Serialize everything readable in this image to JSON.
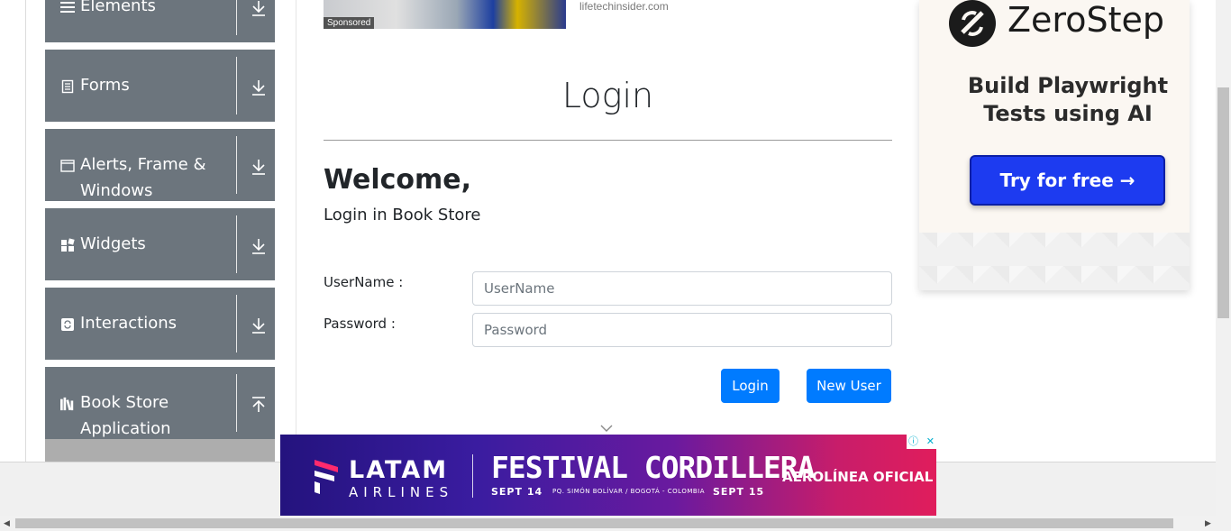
{
  "sidebar": {
    "groups": [
      {
        "label": "Elements",
        "icon": "list-icon",
        "expanded": false
      },
      {
        "label": "Forms",
        "icon": "document-icon",
        "expanded": false
      },
      {
        "label": "Alerts, Frame & Windows",
        "icon": "window-icon",
        "expanded": false
      },
      {
        "label": "Widgets",
        "icon": "grid-icon",
        "expanded": false
      },
      {
        "label": "Interactions",
        "icon": "refresh-icon",
        "expanded": false
      },
      {
        "label": "Book Store Application",
        "icon": "books-icon",
        "expanded": true
      }
    ]
  },
  "top_ad": {
    "sponsored": "Sponsored",
    "domain": "lifetechinsider.com"
  },
  "main": {
    "title": "Login",
    "welcome": "Welcome,",
    "subheading": "Login in Book Store",
    "username_label": "UserName :",
    "username_placeholder": "UserName",
    "password_label": "Password :",
    "password_placeholder": "Password",
    "login_button": "Login",
    "new_user_button": "New User"
  },
  "right_ad": {
    "brand": "ZeroStep",
    "tagline": "Build Playwright Tests using AI",
    "cta": "Try for free →",
    "cta_color": "#1d3bf0"
  },
  "banner_ad": {
    "brand": "LATAM",
    "brand_sub": "AIRLINES",
    "festival": "FESTIVAL CORDILLERA",
    "date_start": "SEPT 14",
    "location": "PQ. SIMÓN BOLÍVAR / BOGOTÁ - COLOMBIA",
    "date_end": "SEPT 15",
    "tag": "AEROLÍNEA OFICIAL"
  },
  "colors": {
    "sidebar_bg": "#6c757d",
    "primary_button": "#007bff",
    "active_sub_bg": "#adadad"
  }
}
